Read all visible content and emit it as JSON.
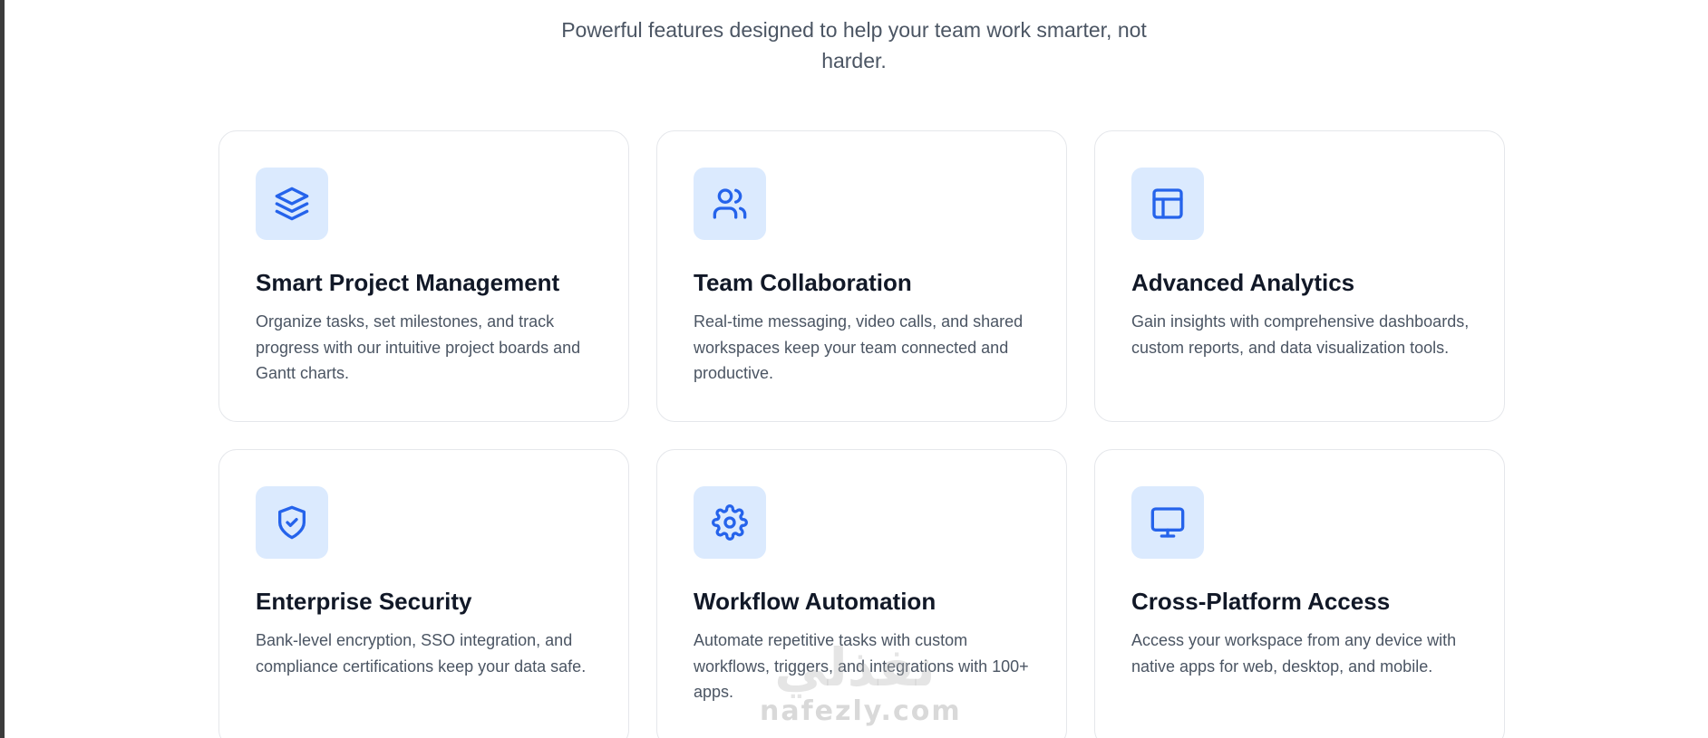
{
  "header": {
    "subtitle": "Powerful features designed to help your team work smarter, not harder."
  },
  "features": [
    {
      "icon": "layers-icon",
      "title": "Smart Project Management",
      "description": "Organize tasks, set milestones, and track progress with our intuitive project boards and Gantt charts."
    },
    {
      "icon": "users-icon",
      "title": "Team Collaboration",
      "description": "Real-time messaging, video calls, and shared workspaces keep your team connected and productive."
    },
    {
      "icon": "layout-icon",
      "title": "Advanced Analytics",
      "description": "Gain insights with comprehensive dashboards, custom reports, and data visualization tools."
    },
    {
      "icon": "shield-check-icon",
      "title": "Enterprise Security",
      "description": "Bank-level encryption, SSO integration, and compliance certifications keep your data safe."
    },
    {
      "icon": "gear-icon",
      "title": "Workflow Automation",
      "description": "Automate repetitive tasks with custom workflows, triggers, and integrations with 100+ apps."
    },
    {
      "icon": "monitor-icon",
      "title": "Cross-Platform Access",
      "description": "Access your workspace from any device with native apps for web, desktop, and mobile."
    }
  ],
  "watermark": {
    "main": "نفذلي",
    "sub": "nafezly.com"
  },
  "colors": {
    "accent": "#2563eb",
    "icon_bg": "#dbeafe",
    "title": "#111827",
    "body": "#4b5563",
    "border": "#e5e7eb"
  }
}
